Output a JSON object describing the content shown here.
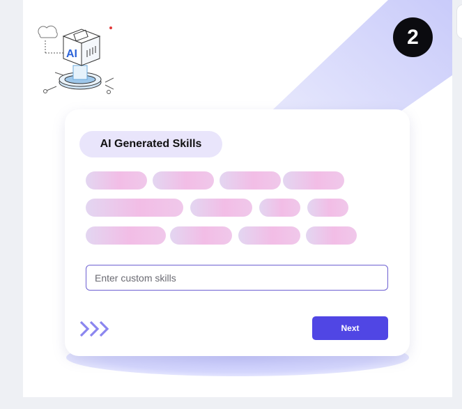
{
  "step": {
    "number": "2"
  },
  "illustration": {
    "label": "AI",
    "icon": "ai-cube-icon"
  },
  "card": {
    "title": "AI Generated Skills",
    "chips": [
      {
        "row": 1,
        "count": 4
      },
      {
        "row": 2,
        "count": 4
      },
      {
        "row": 3,
        "count": 4
      }
    ],
    "custom_input": {
      "value": "",
      "placeholder": "Enter custom skills"
    },
    "next_label": "Next",
    "arrows_icon": "triple-chevron-right-icon"
  },
  "colors": {
    "accent": "#5046e4",
    "badge": "#0b0b0f",
    "chip_start": "#e3d6f1",
    "chip_mid": "#f2bde6",
    "title_pill": "#e9e5fb",
    "diagonal": "#d4d5fb"
  }
}
